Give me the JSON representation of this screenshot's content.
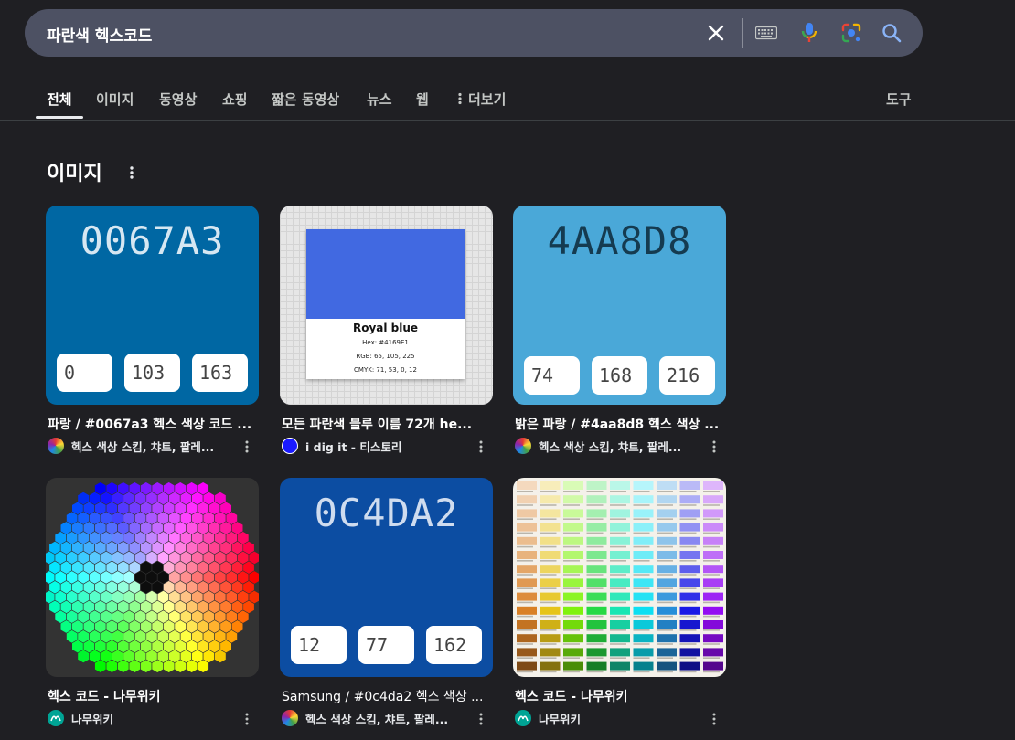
{
  "search": {
    "query": "파란색 헥스코드"
  },
  "tabs": [
    {
      "label": "전체",
      "active": true
    },
    {
      "label": "이미지"
    },
    {
      "label": "동영상"
    },
    {
      "label": "쇼핑"
    },
    {
      "label": "짧은 동영상"
    },
    {
      "label": "뉴스"
    },
    {
      "label": "웹"
    },
    {
      "label": "더보기"
    }
  ],
  "tools_label": "도구",
  "section": {
    "title": "이미지"
  },
  "cards": [
    {
      "title": "파랑 / #0067a3 헥스 색상 코드 ...",
      "source": "헥스 색상 스킴, 챠트, 팔레...",
      "hex": "0067A3",
      "r": "0",
      "g": "103",
      "b": "163",
      "bg": "#0067a3",
      "fg": "#d6e7f2"
    },
    {
      "title": "모든 파란색 블루 이름 72개 he...",
      "source": "i dig it - 티스토리",
      "swatch_name": "Royal blue",
      "swatch_hex": "Hex: #4169E1",
      "swatch_rgb": "RGB: 65, 105, 225",
      "swatch_cmyk": "CMYK: 71, 53, 0, 12",
      "swatch_color": "#4169e1"
    },
    {
      "title": "밝은 파랑 / #4aa8d8 헥스 색상 ...",
      "source": "헥스 색상 스킴, 챠트, 팔레...",
      "hex": "4AA8D8",
      "r": "74",
      "g": "168",
      "b": "216",
      "bg": "#4aa8d8",
      "fg": "#153b50"
    },
    {
      "title": "헥스 코드 - 나무위키",
      "source": "나무위키"
    },
    {
      "title": "Samsung / #0c4da2 헥스 색상 ...",
      "source": "헥스 색상 스킴, 챠트, 팔레...",
      "hex": "0C4DA2",
      "r": "12",
      "g": "77",
      "b": "162",
      "bg": "#0c4da2",
      "fg": "#cfdcef"
    },
    {
      "title": "헥스 코드 - 나무위키",
      "source": "나무위키"
    }
  ]
}
